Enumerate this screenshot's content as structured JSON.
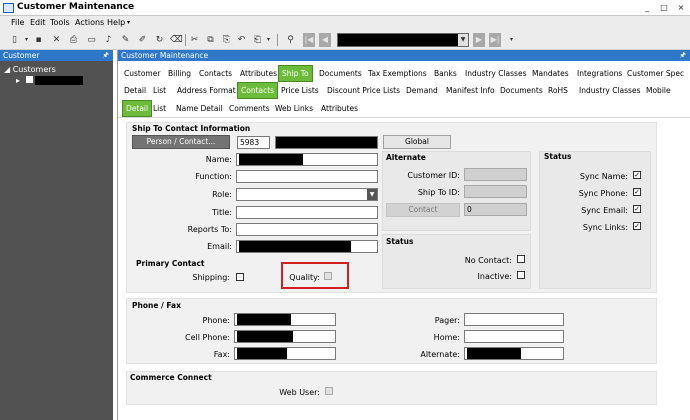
{
  "window": {
    "title": "Customer Maintenance",
    "controls": [
      "_",
      "□",
      "×"
    ]
  },
  "menu": {
    "items": [
      "File",
      "Edit",
      "Tools",
      "Actions",
      "Help"
    ]
  },
  "toolbar": {
    "record_dropdown_value": ""
  },
  "left_panel": {
    "title": "Customer",
    "tree_root": "Customers",
    "tree_child": ""
  },
  "main_panel": {
    "title": "Customer Maintenance"
  },
  "tabs_row1": [
    "Customer",
    "Billing",
    "Contacts",
    "Attributes",
    "Ship To",
    "Documents",
    "Tax Exemptions",
    "Banks",
    "Industry Classes",
    "Mandates",
    "Integrations",
    "Customer Spec"
  ],
  "tabs_row2": [
    "Detail",
    "List",
    "Address Format",
    "Contacts",
    "Price Lists",
    "Discount Price Lists",
    "Demand",
    "Manifest Info",
    "Documents",
    "RoHS",
    "Industry Classes",
    "Mobile"
  ],
  "tabs_row3": [
    "Detail",
    "List",
    "Name Detail",
    "Comments",
    "Web Links",
    "Attributes"
  ],
  "contact_info": {
    "group_title": "Ship To Contact Information",
    "person_contact_button": "Person / Contact...",
    "contact_number": "5983",
    "global_button": "Global",
    "labels": {
      "name": "Name:",
      "function": "Function:",
      "role": "Role:",
      "title": "Title:",
      "reports_to": "Reports To:",
      "email": "Email:"
    }
  },
  "primary_contact": {
    "title": "Primary Contact",
    "shipping_label": "Shipping:",
    "quality_label": "Quality:"
  },
  "alternate": {
    "title": "Alternate",
    "customer_id_label": "Customer ID:",
    "ship_to_id_label": "Ship To ID:",
    "contact_button": "Contact",
    "contact_value": "0"
  },
  "status_middle": {
    "title": "Status",
    "no_contact_label": "No Contact:",
    "inactive_label": "Inactive:"
  },
  "status_right": {
    "title": "Status",
    "sync_name_label": "Sync Name:",
    "sync_phone_label": "Sync Phone:",
    "sync_email_label": "Sync Email:",
    "sync_links_label": "Sync Links:",
    "check_mark": "✓"
  },
  "phone_fax": {
    "title": "Phone / Fax",
    "phone_label": "Phone:",
    "cell_phone_label": "Cell Phone:",
    "fax_label": "Fax:",
    "pager_label": "Pager:",
    "home_label": "Home:",
    "alternate_label": "Alternate:"
  },
  "commerce_connect": {
    "title": "Commerce Connect",
    "web_user_label": "Web User:"
  },
  "colors": {
    "accent_tab": "#6dbb3a",
    "panel_header": "#2f77c8",
    "highlight": "#d21f1f"
  }
}
